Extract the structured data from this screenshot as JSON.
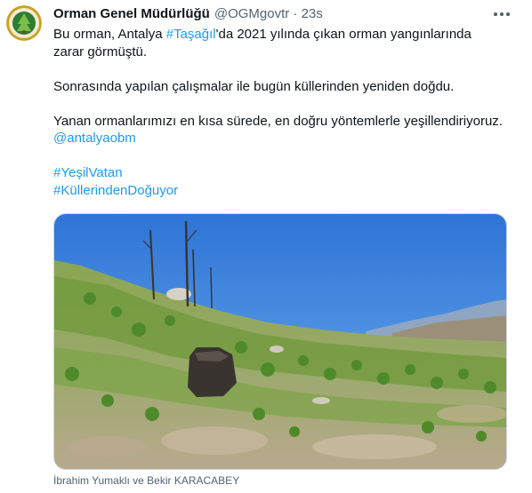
{
  "tweet": {
    "author_name": "Orman Genel Müdürlüğü",
    "author_handle": "@OGMgovtr",
    "separator": "·",
    "time": "23s",
    "line1_pre": "Bu orman, Antalya ",
    "line1_hashtag": "#Taşağıl",
    "line1_post": "'da 2021 yılında çıkan orman yangınlarında",
    "line2": "zarar görmüştü.",
    "paragraph2": "Sonrasında yapılan çalışmalar ile bugün küllerinden yeniden doğdu.",
    "paragraph3": "Yanan ormanlarımızı en kısa sürede, en doğru yöntemlerle yeşillendiriyoruz.",
    "mention": "@antalyaobm",
    "hashtag1": "#YeşilVatan",
    "hashtag2": "#KüllerindenDoğuyor",
    "photo_credit": "İbrahim Yumaklı ve Bekir KARACABEY"
  },
  "icons": {
    "avatar": "ogm-logo-icon",
    "more": "more-options-icon"
  },
  "colors": {
    "link": "#1d9bf0",
    "secondary_text": "#536471"
  }
}
